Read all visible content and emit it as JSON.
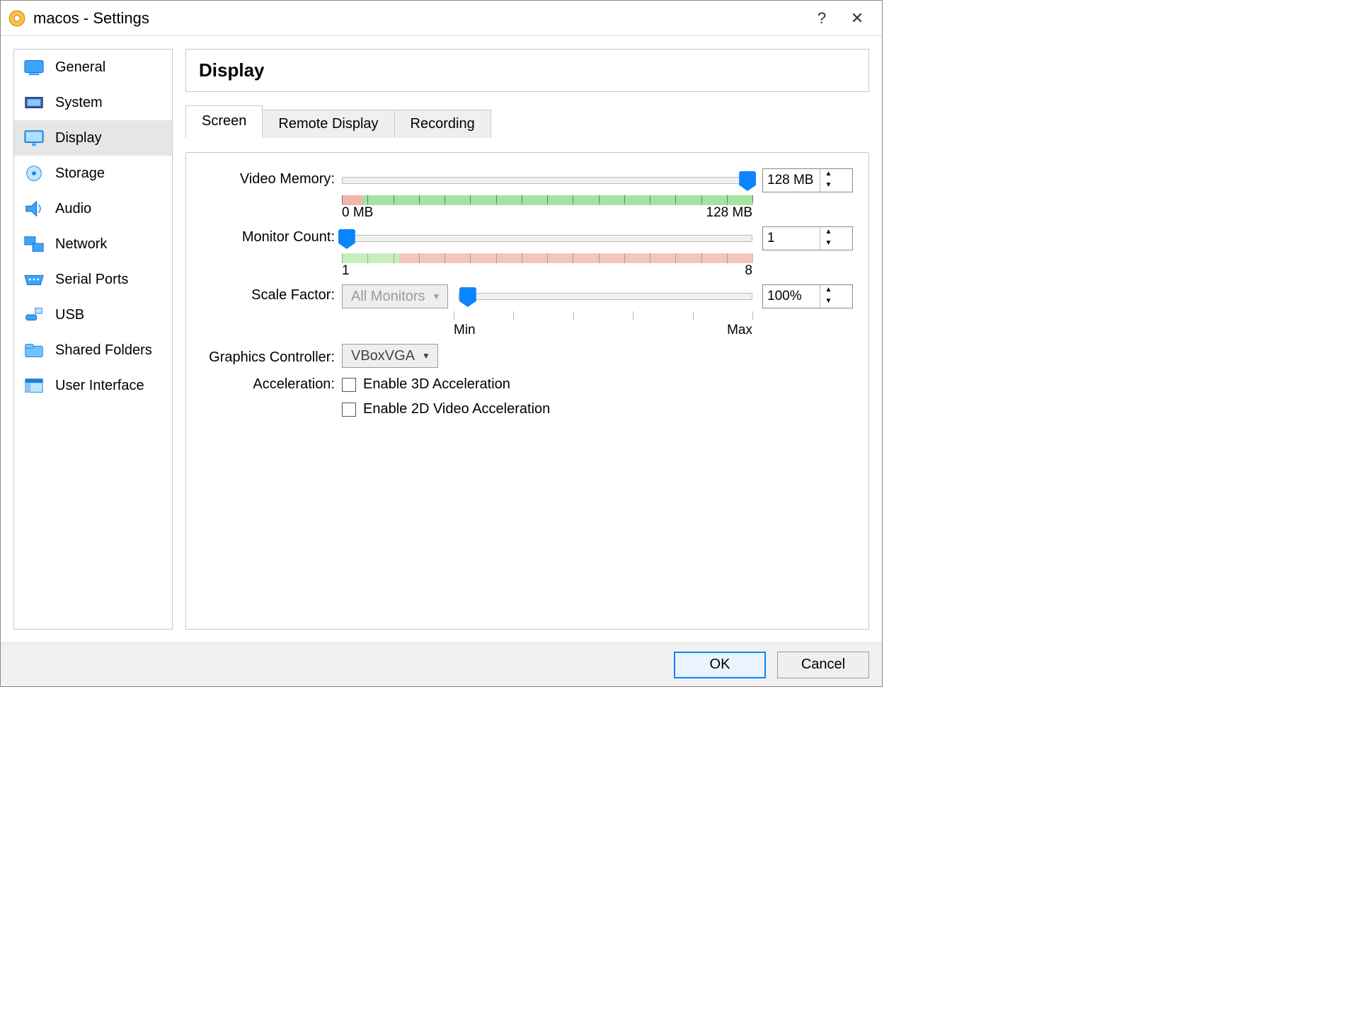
{
  "window": {
    "title": "macos - Settings"
  },
  "sidebar": {
    "items": [
      {
        "label": "General"
      },
      {
        "label": "System"
      },
      {
        "label": "Display"
      },
      {
        "label": "Storage"
      },
      {
        "label": "Audio"
      },
      {
        "label": "Network"
      },
      {
        "label": "Serial Ports"
      },
      {
        "label": "USB"
      },
      {
        "label": "Shared Folders"
      },
      {
        "label": "User Interface"
      }
    ],
    "active_index": 2
  },
  "heading": "Display",
  "tabs": {
    "items": [
      "Screen",
      "Remote Display",
      "Recording"
    ],
    "active_index": 0
  },
  "screen": {
    "video_memory": {
      "label": "Video Memory:",
      "value_text": "128 MB",
      "scale_min_text": "0 MB",
      "scale_max_text": "128 MB",
      "slider_fraction": 0.99,
      "red_fraction": 0.05
    },
    "monitor_count": {
      "label": "Monitor Count:",
      "value_text": "1",
      "scale_min_text": "1",
      "scale_max_text": "8",
      "slider_fraction": 0.01,
      "red_start_fraction": 0.14
    },
    "scale_factor": {
      "label": "Scale Factor:",
      "combo_text": "All Monitors",
      "value_text": "100%",
      "scale_min_text": "Min",
      "scale_max_text": "Max",
      "slider_fraction": 0.03
    },
    "graphics_controller": {
      "label": "Graphics Controller:",
      "value": "VBoxVGA"
    },
    "acceleration": {
      "label": "Acceleration:",
      "enable_3d": "Enable 3D Acceleration",
      "enable_2d": "Enable 2D Video Acceleration"
    }
  },
  "footer": {
    "ok": "OK",
    "cancel": "Cancel"
  }
}
